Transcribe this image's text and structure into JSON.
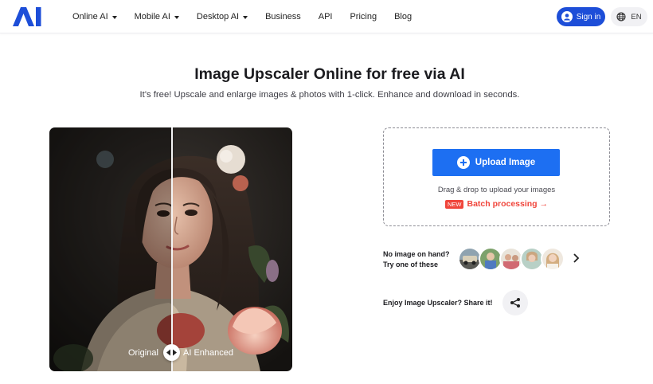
{
  "header": {
    "logo": "AI",
    "nav": [
      {
        "label": "Online AI",
        "has_dropdown": true
      },
      {
        "label": "Mobile AI",
        "has_dropdown": true
      },
      {
        "label": "Desktop AI",
        "has_dropdown": true
      },
      {
        "label": "Business",
        "has_dropdown": false
      },
      {
        "label": "API",
        "has_dropdown": false
      },
      {
        "label": "Pricing",
        "has_dropdown": false
      },
      {
        "label": "Blog",
        "has_dropdown": false
      }
    ],
    "signin_label": "Sign in",
    "language": "EN",
    "colors": {
      "primary": "#1d4ed8",
      "logo": "#1d4ed8"
    }
  },
  "hero": {
    "title": "Image Upscaler Online for free via AI",
    "subtitle": "It's free! Upscale and enlarge images & photos with 1-click. Enhance and download in seconds."
  },
  "compare": {
    "left_label": "Original",
    "right_label": "AI Enhanced",
    "icons": [
      "compare-handle-icon"
    ]
  },
  "upload": {
    "button_label": "Upload Image",
    "drag_text": "Drag & drop to upload your images",
    "badge": "NEW",
    "batch_label": "Batch processing →",
    "colors": {
      "button": "#1d6ff2",
      "batch": "#f0453b"
    }
  },
  "samples": {
    "line1": "No image on hand?",
    "line2": "Try one of these",
    "count": 5
  },
  "share": {
    "label": "Enjoy Image Upscaler? Share it!"
  }
}
